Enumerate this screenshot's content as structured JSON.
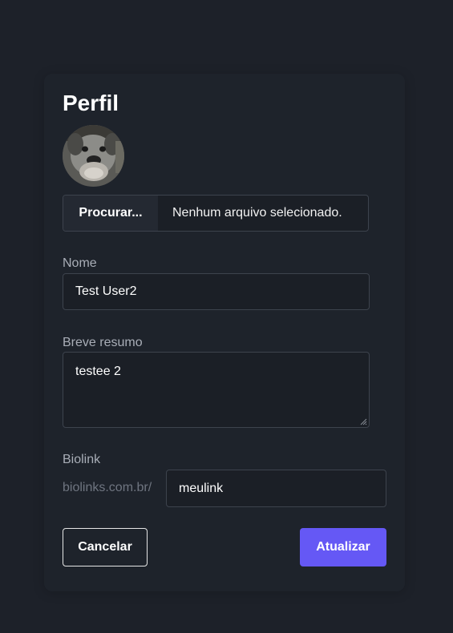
{
  "profile": {
    "title": "Perfil",
    "file_button_label": "Procurar...",
    "file_status": "Nenhum arquivo selecionado.",
    "name_label": "Nome",
    "name_value": "Test User2",
    "summary_label": "Breve resumo",
    "summary_value": "testee 2",
    "biolink_label": "Biolink",
    "biolink_prefix": "biolinks.com.br/",
    "biolink_value": "meulink",
    "cancel_label": "Cancelar",
    "update_label": "Atualizar"
  },
  "colors": {
    "background": "#1d2129",
    "input_border": "#3d434d",
    "accent": "#6558f5",
    "label": "#a9aeb7"
  },
  "icons": {
    "avatar": "dog-avatar-photo",
    "textarea_resize": "resize-grip-icon"
  }
}
